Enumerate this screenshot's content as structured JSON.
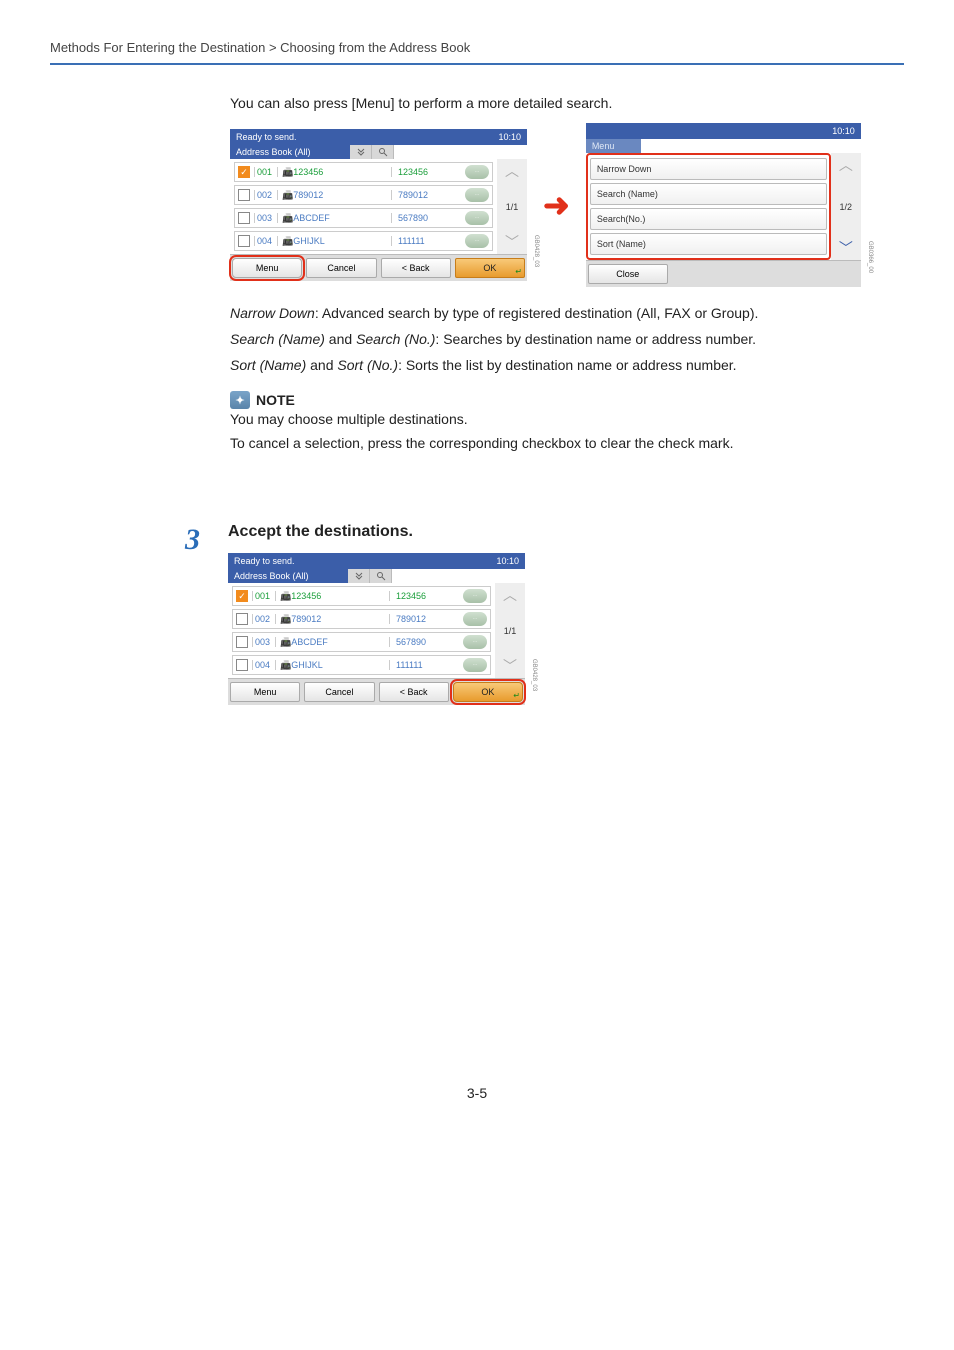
{
  "breadcrumb": "Methods For Entering the Destination > Choosing from the Address Book",
  "intro": "You can also press [Menu] to perform a more detailed search.",
  "lcd_left": {
    "title": "Ready to send.",
    "time": "10:10",
    "subtitle": "Address Book (All)",
    "rows": [
      {
        "checked": true,
        "num": "001",
        "name": "123456",
        "val": "123456",
        "sel": true
      },
      {
        "checked": false,
        "num": "002",
        "name": "789012",
        "val": "789012",
        "sel": false
      },
      {
        "checked": false,
        "num": "003",
        "name": "ABCDEF",
        "val": "567890",
        "sel": false
      },
      {
        "checked": false,
        "num": "004",
        "name": "GHIJKL",
        "val": "111111",
        "sel": false
      }
    ],
    "page": "1/1",
    "footer": {
      "menu": "Menu",
      "cancel": "Cancel",
      "back": "< Back",
      "ok": "OK"
    },
    "tag": "GB0428_03"
  },
  "lcd_menu": {
    "time": "10:10",
    "tab": "Menu",
    "items": [
      "Narrow Down",
      "Search (Name)",
      "Search(No.)",
      "Sort (Name)"
    ],
    "page": "1/2",
    "close": "Close",
    "tag": "GB0366_00"
  },
  "desc": {
    "l1a": "Narrow Down",
    "l1b": ": Advanced search by type of registered destination (All, FAX or Group).",
    "l2a": "Search (Name)",
    "l2and": " and ",
    "l2b": "Search (No.)",
    "l2c": ": Searches by destination name or address number.",
    "l3a": "Sort (Name)",
    "l3and": " and ",
    "l3b": "Sort (No.)",
    "l3c": ": Sorts the list by destination name or address number."
  },
  "note": {
    "head": "NOTE",
    "l1": "You may choose multiple destinations.",
    "l2": "To cancel a selection, press the corresponding checkbox to clear the check mark."
  },
  "step3": {
    "num": "3",
    "title": "Accept the destinations.",
    "lcd": {
      "title": "Ready to send.",
      "time": "10:10",
      "subtitle": "Address Book (All)",
      "rows": [
        {
          "checked": true,
          "num": "001",
          "name": "123456",
          "val": "123456",
          "sel": true
        },
        {
          "checked": false,
          "num": "002",
          "name": "789012",
          "val": "789012",
          "sel": false
        },
        {
          "checked": false,
          "num": "003",
          "name": "ABCDEF",
          "val": "567890",
          "sel": false
        },
        {
          "checked": false,
          "num": "004",
          "name": "GHIJKL",
          "val": "111111",
          "sel": false
        }
      ],
      "page": "1/1",
      "footer": {
        "menu": "Menu",
        "cancel": "Cancel",
        "back": "< Back",
        "ok": "OK"
      },
      "tag": "GB0428_03"
    }
  },
  "page_number": "3-5"
}
